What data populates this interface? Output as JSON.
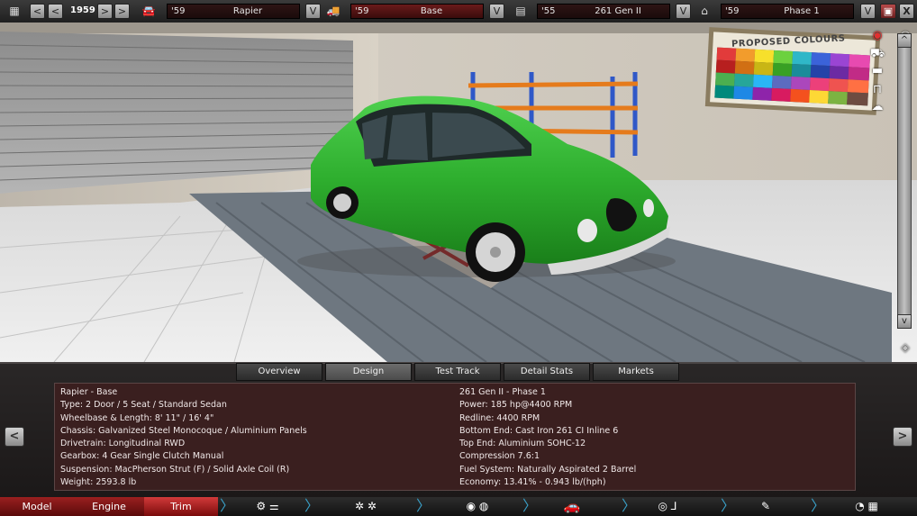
{
  "topbar": {
    "year": "1959",
    "model": {
      "year": "'59",
      "name": "Rapier"
    },
    "trim": {
      "year": "'59",
      "name": "Base"
    },
    "engine": {
      "year": "'55",
      "name": "261 Gen II"
    },
    "variant": {
      "year": "'59",
      "name": "Phase 1"
    },
    "dropdown_label": "V",
    "prev_fast_label": "<",
    "prev_label": "<",
    "next_label": ">",
    "next_fast_label": ">",
    "close_label": "X"
  },
  "scene": {
    "poster_title": "PROPOSED COLOURS",
    "car_color": "#2eae2e"
  },
  "info_tabs": [
    "Overview",
    "Design",
    "Test Track",
    "Detail Stats",
    "Markets"
  ],
  "active_tab": "Design",
  "details_left": [
    "Rapier - Base",
    "Type: 2 Door / 5 Seat / Standard Sedan",
    "Wheelbase & Length: 8' 11\" / 16' 4\"",
    "Chassis: Galvanized Steel Monocoque / Aluminium Panels",
    "Drivetrain: Longitudinal RWD",
    "Gearbox: 4 Gear Single Clutch Manual",
    "Suspension: MacPherson Strut (F) / Solid Axle Coil (R)",
    "Weight: 2593.8 lb"
  ],
  "details_right": [
    "261 Gen II - Phase 1",
    "Power: 185 hp@4400 RPM",
    "Redline: 4400 RPM",
    "Bottom End: Cast Iron 261 CI Inline 6",
    "Top End: Aluminium SOHC-12",
    "Compression 7.6:1",
    "Fuel System: Naturally Aspirated 2 Barrel",
    "Economy: 13.41% - 0.943 lb/(hph)"
  ],
  "side_arrows": {
    "left": "<",
    "right": ">"
  },
  "scroll": {
    "up": "^",
    "down": "v"
  },
  "bottom_nav": {
    "model": "Model",
    "engine": "Engine",
    "trim": "Trim"
  },
  "colors": {
    "accent_red": "#a01818",
    "nav_separator": "#3aa0c8"
  }
}
